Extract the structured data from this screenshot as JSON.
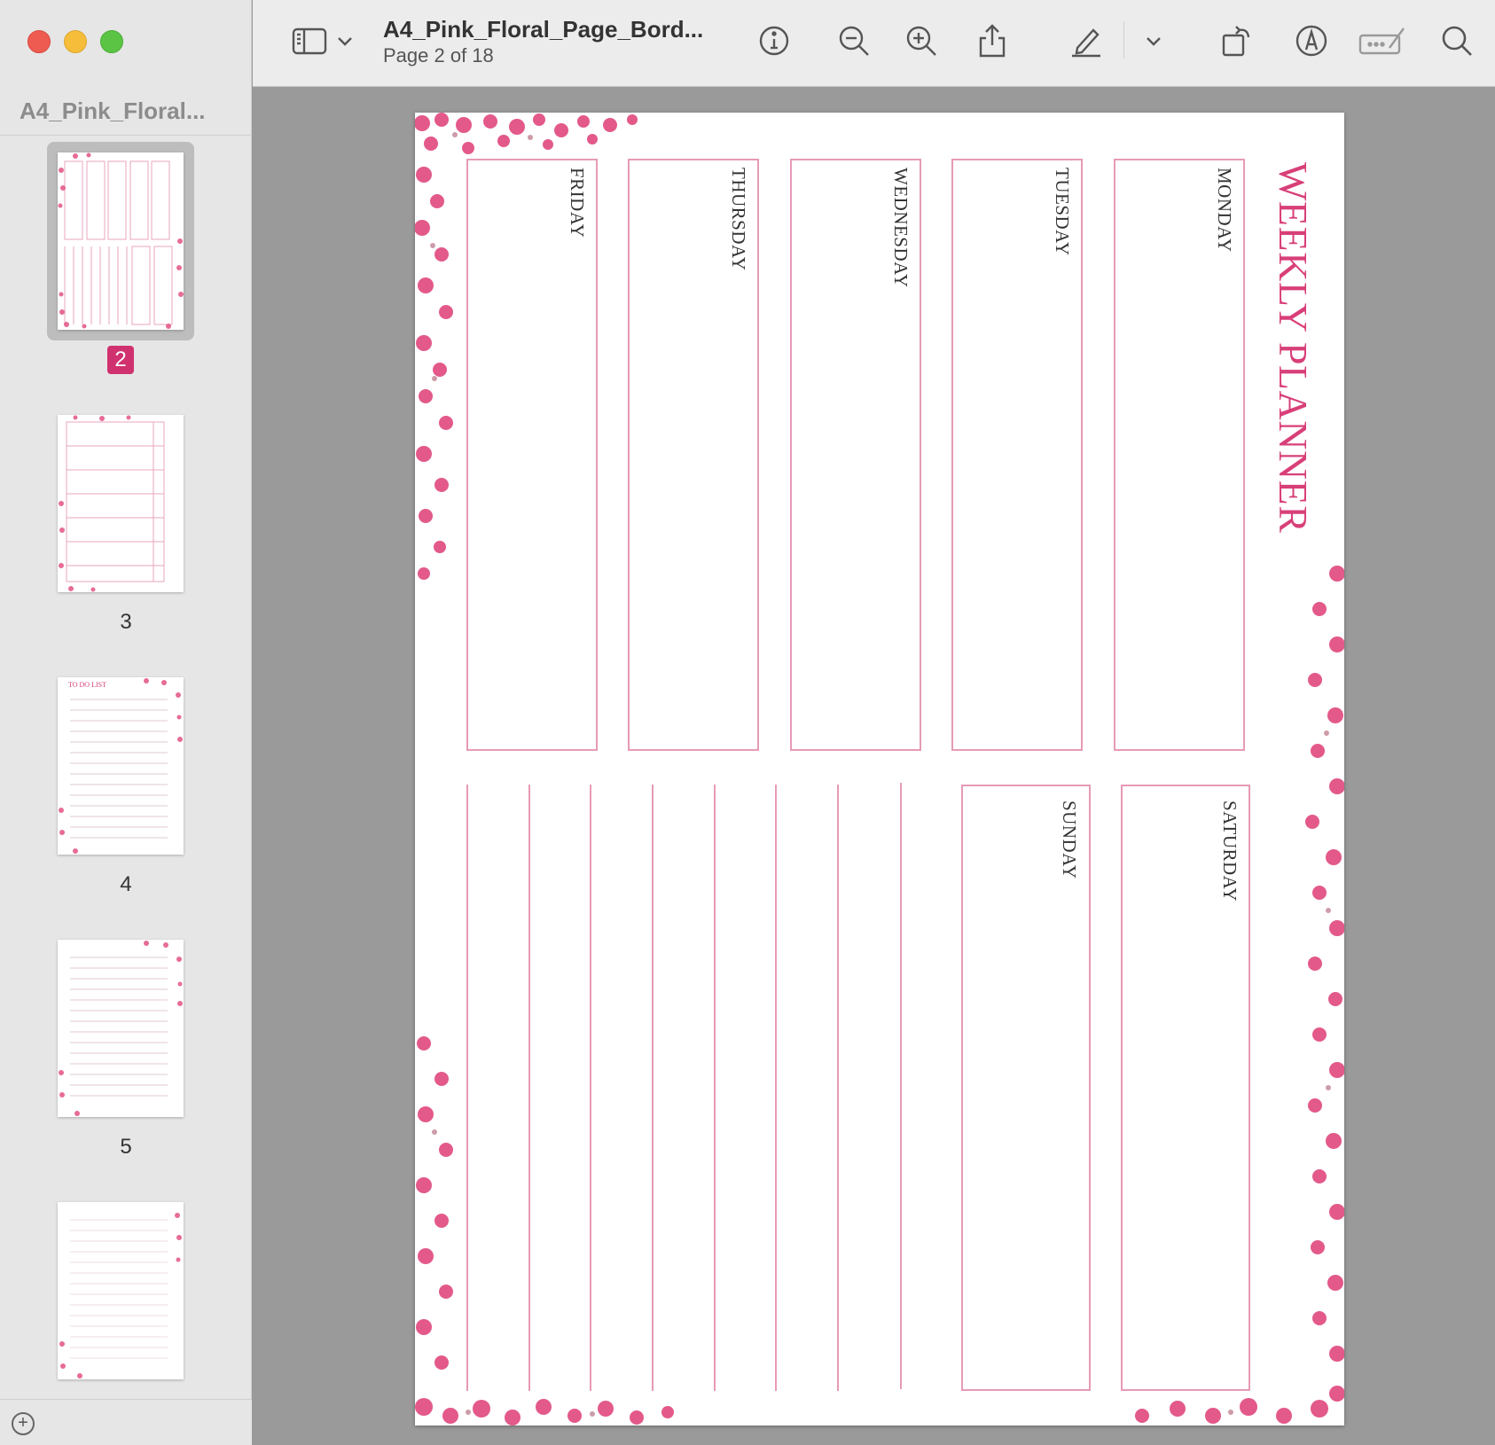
{
  "window": {
    "doc_title": "A4_Pink_Floral_Page_Bord...",
    "page_indicator": "Page 2 of 18"
  },
  "sidebar": {
    "title": "A4_Pink_Floral...",
    "thumbnails": [
      {
        "number": "2",
        "selected": true
      },
      {
        "number": "3",
        "selected": false
      },
      {
        "number": "4",
        "selected": false
      },
      {
        "number": "5",
        "selected": false
      },
      {
        "number": "",
        "selected": false
      }
    ],
    "thumb_texts": {
      "weekly_planner": "WEEKLY PLANNER",
      "to_do_list": "TO DO LIST"
    }
  },
  "toolbar": {
    "icons": [
      "sidebar-toggle-icon",
      "chevron-down-icon",
      "info-icon",
      "zoom-out-icon",
      "zoom-in-icon",
      "share-icon",
      "highlight-pen-icon",
      "chevron-down-icon",
      "rotate-icon",
      "markup-icon",
      "form-fill-icon",
      "search-icon"
    ]
  },
  "planner": {
    "title": "WEEKLY PLANNER",
    "days": {
      "monday": "MONDAY",
      "tuesday": "TUESDAY",
      "wednesday": "WEDNESDAY",
      "thursday": "THURSDAY",
      "friday": "FRIDAY",
      "saturday": "SATURDAY",
      "sunday": "SUNDAY"
    }
  },
  "colors": {
    "accent": "#d83f78",
    "box_border": "#e79ab7",
    "badge": "#d0316f",
    "flower": "#e0487e"
  }
}
